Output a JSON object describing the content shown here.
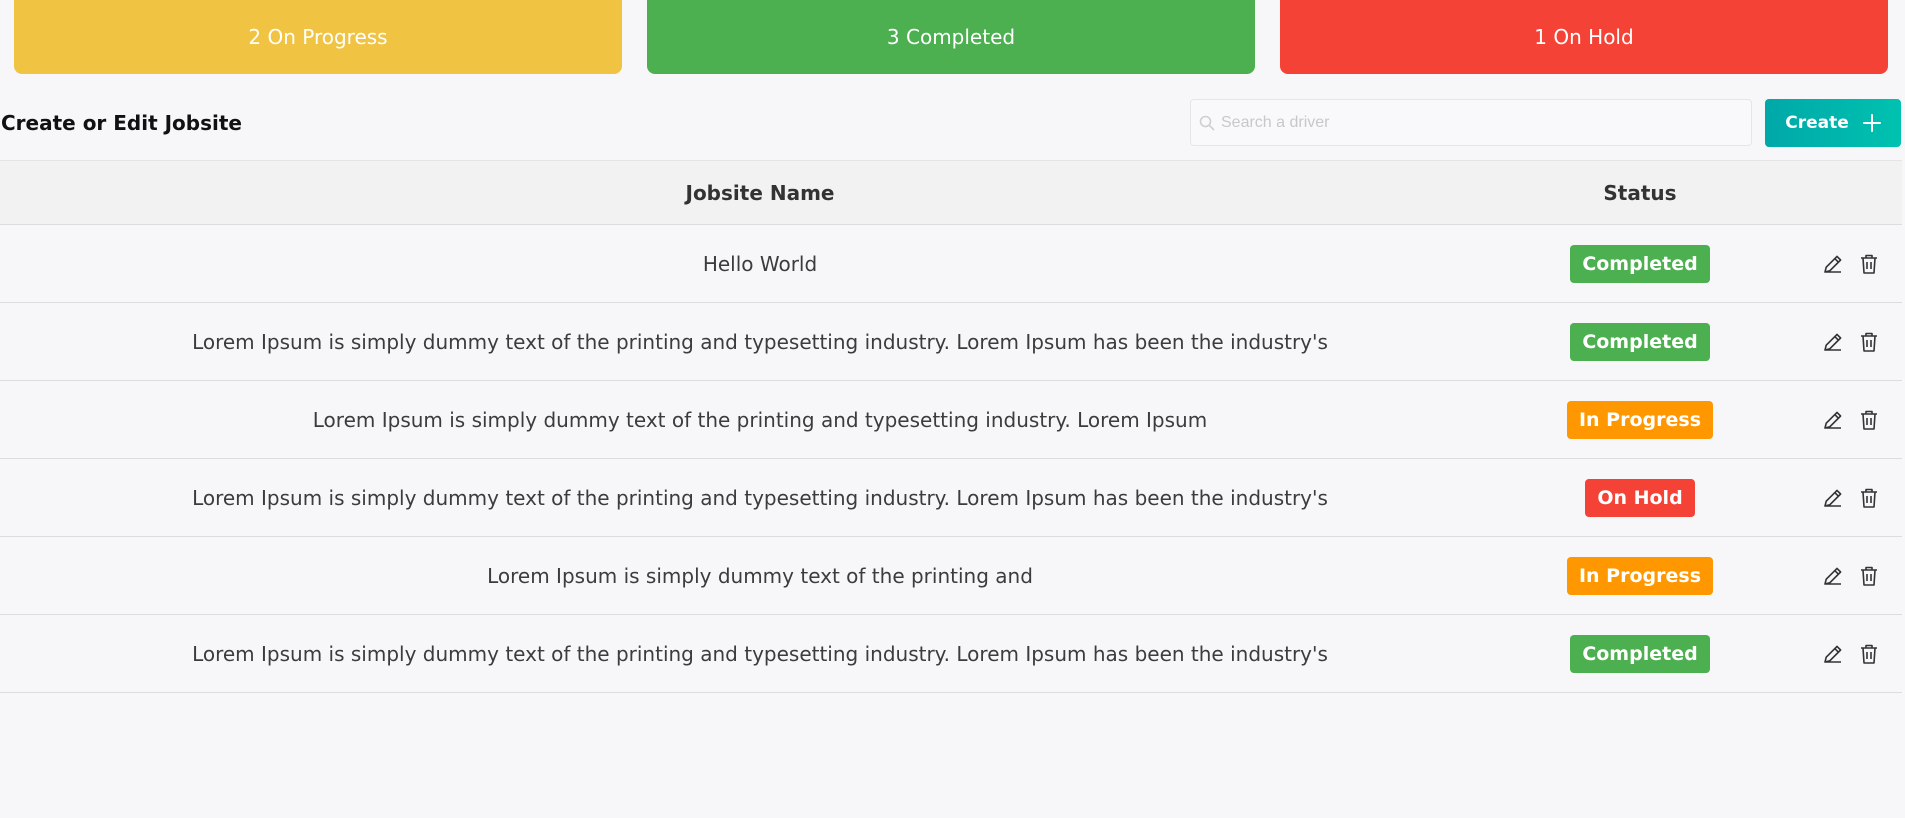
{
  "summary": {
    "on_progress": "2 On Progress",
    "completed": "3 Completed",
    "on_hold": "1 On Hold"
  },
  "toolbar": {
    "title": "Create or Edit Jobsite",
    "search_placeholder": "Search a driver",
    "search_value": "",
    "create_label": "Create"
  },
  "table": {
    "headers": [
      "Jobsite Name",
      "Status"
    ],
    "rows": [
      {
        "name": "Hello World",
        "status": "Completed"
      },
      {
        "name": "Lorem Ipsum is simply dummy text of the printing and typesetting industry. Lorem Ipsum has been the industry's",
        "status": "Completed"
      },
      {
        "name": "Lorem Ipsum is simply dummy text of the printing and typesetting industry. Lorem Ipsum",
        "status": "In Progress"
      },
      {
        "name": "Lorem Ipsum is simply dummy text of the printing and typesetting industry. Lorem Ipsum has been the industry's",
        "status": "On Hold"
      },
      {
        "name": "Lorem Ipsum is simply dummy text of the printing and",
        "status": "In Progress"
      },
      {
        "name": "Lorem Ipsum is simply dummy text of the printing and typesetting industry. Lorem Ipsum has been the industry's",
        "status": "Completed"
      }
    ]
  },
  "icons": {
    "search": "search-icon",
    "create": "plus-icon",
    "edit": "pencil-icon",
    "delete": "trash-icon"
  },
  "colors": {
    "on_progress_card": "#f0c343",
    "completed": "#4caf50",
    "on_hold": "#f44336",
    "in_progress_badge": "#ff9800",
    "create_button": "#00b3ad"
  }
}
